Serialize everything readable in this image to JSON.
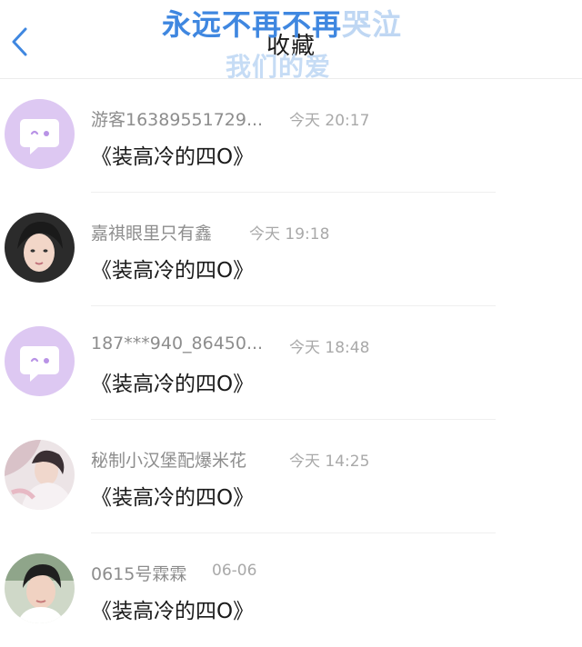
{
  "header": {
    "title": "收藏",
    "overlay_line1_strong": "永远不再不再",
    "overlay_line1_faded": "哭泣",
    "overlay_line2": "我们的爱"
  },
  "items": [
    {
      "user": "游客16389551729...",
      "time": "今天 20:17",
      "title": "《装高冷的四O》",
      "avatar": "default-chat-icon"
    },
    {
      "user": "嘉祺眼里只有鑫",
      "time": "今天 19:18",
      "title": "《装高冷的四O》",
      "avatar": "photo"
    },
    {
      "user": "187***940_86450...",
      "time": "今天 18:48",
      "title": "《装高冷的四O》",
      "avatar": "default-chat-icon"
    },
    {
      "user": "秘制小汉堡配爆米花",
      "time": "今天 14:25",
      "title": "《装高冷的四O》",
      "avatar": "photo"
    },
    {
      "user": "0615号霖霖",
      "time": "06-06",
      "title": "《装高冷的四O》",
      "avatar": "photo"
    }
  ],
  "colors": {
    "accent": "#3f87e0",
    "default_avatar_bg": "#ddc8f2"
  }
}
